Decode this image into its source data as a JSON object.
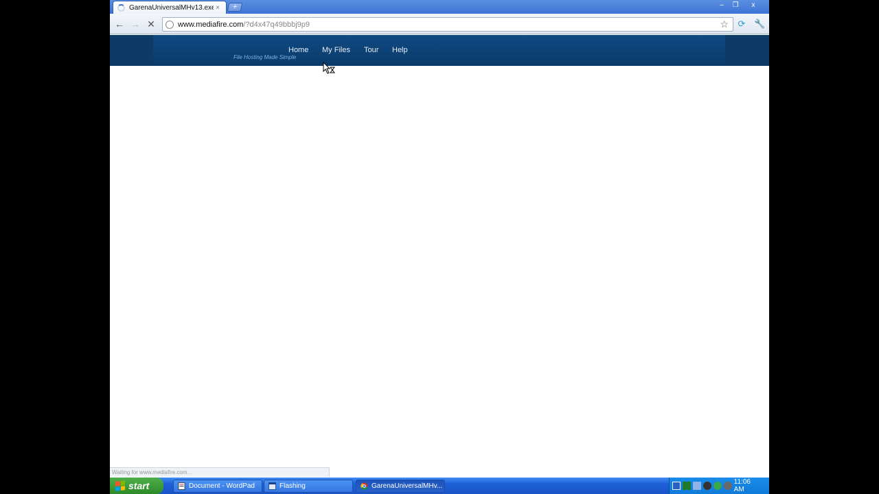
{
  "browser": {
    "tab_title": "GarenaUniversalMHv13.exe",
    "tab_close": "×",
    "new_tab": "+",
    "window_controls": {
      "minimize": "–",
      "restore": "❐",
      "close": "x"
    },
    "url_host": "www.mediafire.com",
    "url_path": "/?d4x47q49bbbj9p9",
    "status_text": "Waiting for www.mediafire.com..."
  },
  "site": {
    "tagline": "File Hosting Made Simple",
    "nav": [
      {
        "label": "Home"
      },
      {
        "label": "My Files"
      },
      {
        "label": "Tour"
      },
      {
        "label": "Help"
      }
    ]
  },
  "taskbar": {
    "start_label": "start",
    "tasks": [
      {
        "label": "Document - WordPad"
      },
      {
        "label": "Flashing"
      },
      {
        "label": "GarenaUniversalMHv..."
      }
    ],
    "clock": "11:06 AM"
  },
  "colors": {
    "site_header": "#0f4a82",
    "taskbar": "#1d5fd6",
    "start": "#2d8a2a"
  }
}
